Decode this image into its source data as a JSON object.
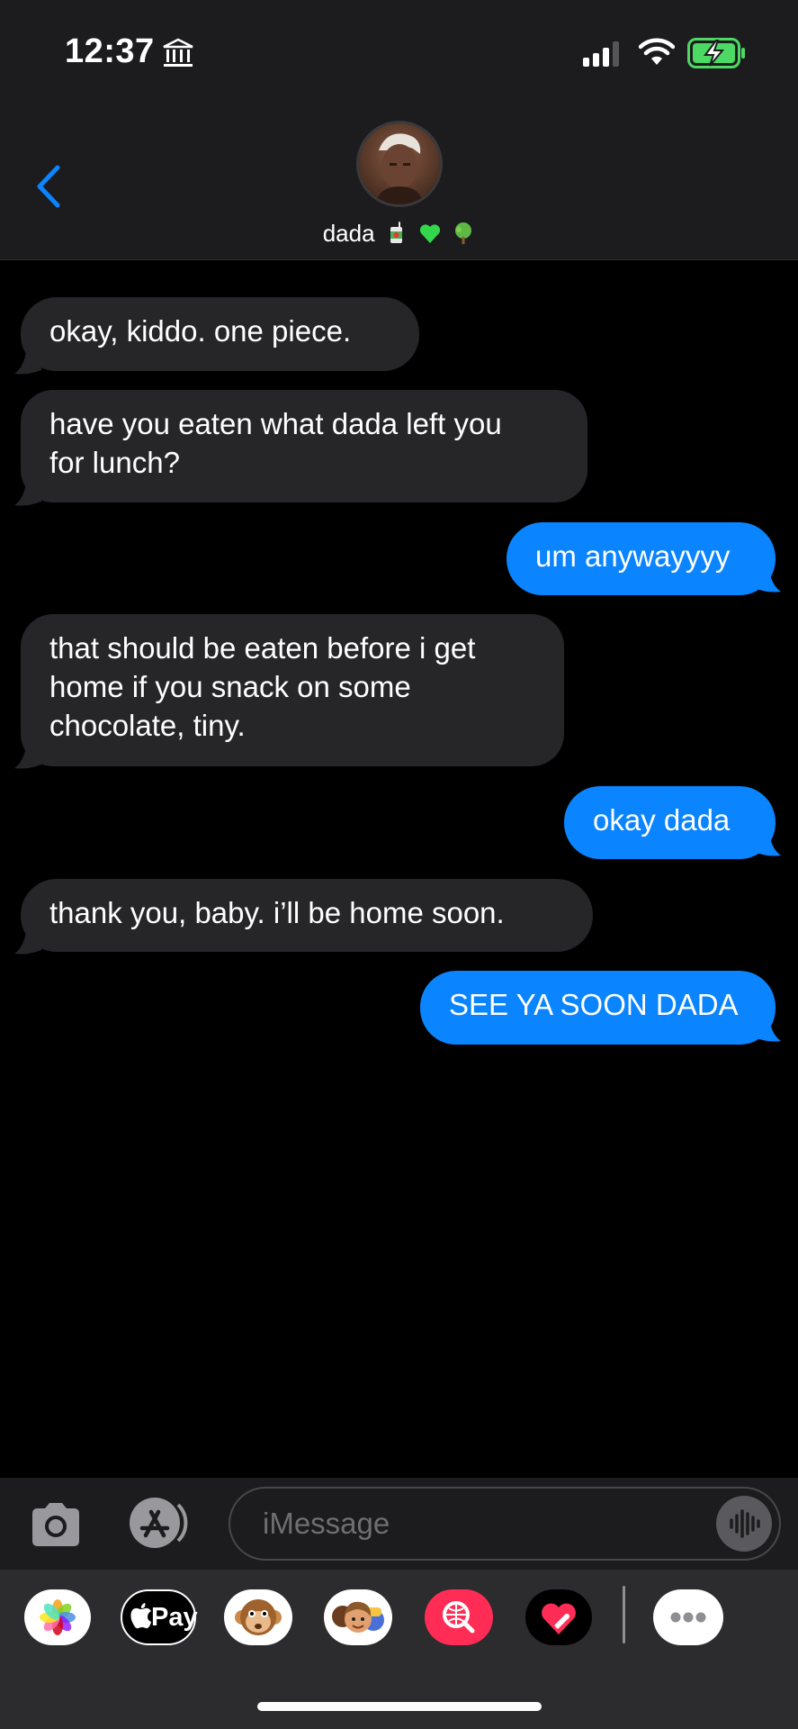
{
  "status_bar": {
    "time": "12:37"
  },
  "contact": {
    "name": "dada"
  },
  "messages": [
    {
      "sender": "them",
      "text": "okay, kiddo. one piece."
    },
    {
      "sender": "them",
      "text_lines": [
        "have you eaten what dada left you",
        "for lunch?"
      ]
    },
    {
      "sender": "me",
      "text": "um anywayyyy"
    },
    {
      "sender": "them",
      "text_lines": [
        "that should be eaten before i get",
        "home if you snack on some",
        "chocolate, tiny."
      ]
    },
    {
      "sender": "me",
      "text": "okay dada"
    },
    {
      "sender": "them",
      "text": "thank you, baby. i’ll be home soon."
    },
    {
      "sender": "me",
      "text": "SEE YA SOON DADA"
    }
  ],
  "input": {
    "placeholder": "iMessage"
  },
  "tray": {
    "apple_pay_label": "Pay",
    "apps": [
      "photos-icon",
      "apple-pay-icon",
      "animoji-icon",
      "memoji-icon",
      "image-search-icon",
      "digital-touch-icon",
      "more-icon"
    ]
  },
  "colors": {
    "outgoing": "#0a84ff",
    "incoming": "#262629",
    "accent": "#0a84ff"
  }
}
